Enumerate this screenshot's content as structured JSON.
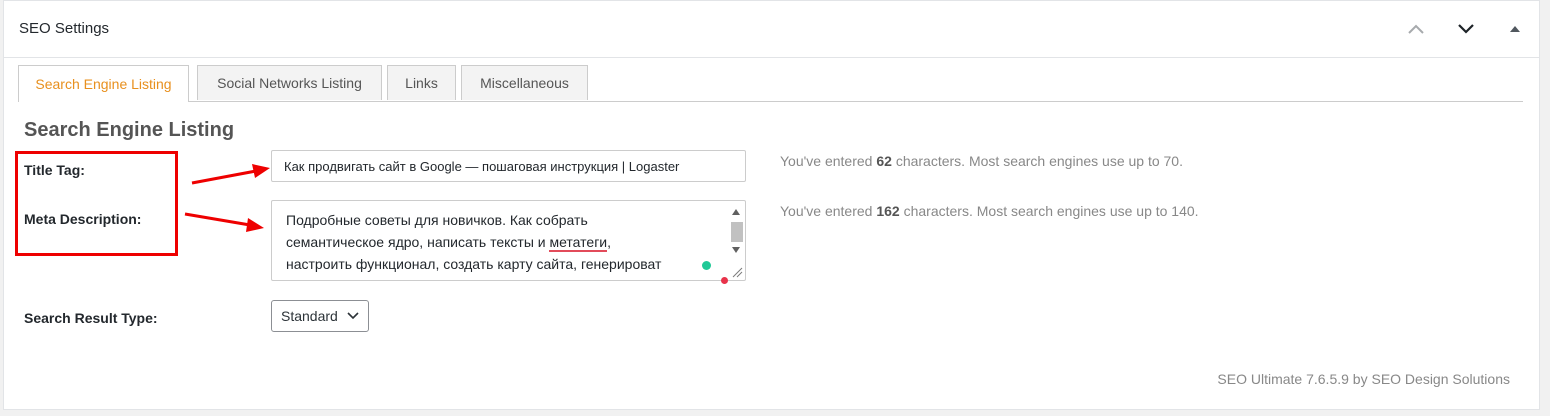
{
  "panel": {
    "title": "SEO Settings"
  },
  "header_buttons": {
    "move_up_icon": "chevron-up-icon",
    "move_down_icon": "chevron-down-icon",
    "toggle_icon": "triangle-up-icon"
  },
  "tabs": [
    {
      "label": "Search Engine Listing",
      "active": true
    },
    {
      "label": "Social Networks Listing",
      "active": false
    },
    {
      "label": "Links",
      "active": false
    },
    {
      "label": "Miscellaneous",
      "active": false
    }
  ],
  "section": {
    "heading": "Search Engine Listing"
  },
  "fields": {
    "title_tag": {
      "label": "Title Tag:",
      "value": "Как продвигать сайт в Google — пошаговая инструкция | Logaster",
      "counter_prefix": "You've entered ",
      "counter_count": "62",
      "counter_suffix": " characters. Most search engines use up to 70."
    },
    "meta_description": {
      "label": "Meta Description:",
      "line1": "Подробные советы для новичков. Как собрать",
      "line2_start": "семантическое ядро, написать тексты и ",
      "line2_misspelled": "метатеги",
      "line2_end": ",",
      "line3": "настроить функционал, создать карту сайта, генерироват",
      "counter_prefix": "You've entered ",
      "counter_count": "162",
      "counter_suffix": " characters. Most search engines use up to 140."
    },
    "search_result_type": {
      "label": "Search Result Type:",
      "selected": "Standard"
    }
  },
  "footer": {
    "credit": "SEO Ultimate 7.6.5.9 by SEO Design Solutions"
  },
  "colors": {
    "active_tab": "#e8901e",
    "annotation": "#ee0000",
    "spellcheck": "#e24b5a",
    "grammar_dot": "#20c997"
  }
}
